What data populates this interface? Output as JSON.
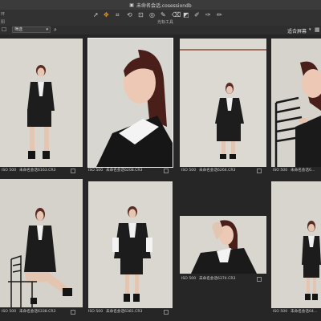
{
  "window": {
    "title": "未命名会话.cosessiondb"
  },
  "toolbar": {
    "label": "光标工具",
    "left_top": "环",
    "left_bottom": "阳",
    "tools": [
      "select-tool",
      "pan-tool",
      "crop-tool",
      "rotate-tool",
      "keystone-tool",
      "spot-tool",
      "brush-tool",
      "eraser-tool",
      "gradient-tool",
      "eyedropper-tool",
      "picker-tool",
      "annotate-tool"
    ]
  },
  "filterbar": {
    "sort_value": "筛选",
    "fit_label": "适合屏幕"
  },
  "thumbnails": [
    {
      "iso": "ISO 500",
      "name": "未命名会话6163.CR3",
      "selected": false
    },
    {
      "iso": "ISO 500",
      "name": "未命名会话6208.CR3",
      "selected": true
    },
    {
      "iso": "ISO 500",
      "name": "未命名会话6264.CR3",
      "selected": false
    },
    {
      "iso": "ISO 500",
      "name": "未命名会话6...",
      "selected": false
    },
    {
      "iso": "ISO 500",
      "name": "未命名会话6338.CR3",
      "selected": false
    },
    {
      "iso": "ISO 500",
      "name": "未命名会话6381.CR3",
      "selected": false
    },
    {
      "iso": "ISO 500",
      "name": "未命名会话6374.CR3",
      "selected": false
    },
    {
      "iso": "ISO 500",
      "name": "未命名会话64...",
      "selected": false
    }
  ]
}
